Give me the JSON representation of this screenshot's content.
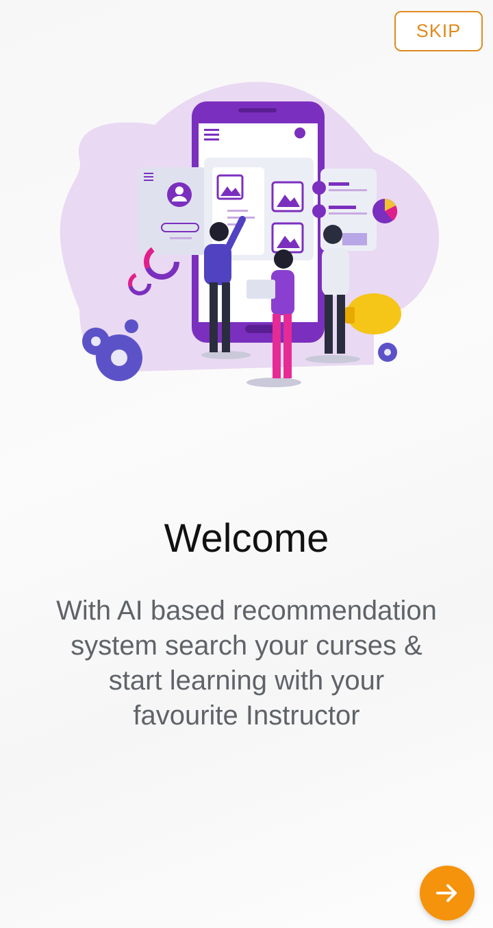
{
  "header": {
    "skip_label": "SKIP"
  },
  "onboarding": {
    "title": "Welcome",
    "description": "With AI based recommendation system search your curses & start learning with your favourite Instructor"
  },
  "navigation": {
    "next_icon": "arrow-right-icon"
  },
  "colors": {
    "accent_orange": "#f5930c",
    "skip_orange": "#e08a1e",
    "illustration_purple": "#7b2fbe",
    "illustration_pink": "#e0208a"
  }
}
